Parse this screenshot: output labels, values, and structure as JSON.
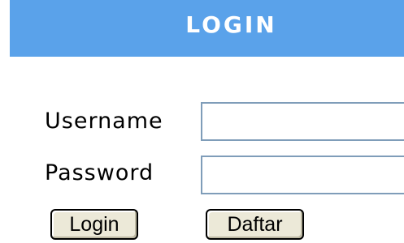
{
  "header": {
    "title": "LOGIN"
  },
  "form": {
    "username_label": "Username",
    "username_value": "",
    "password_label": "Password",
    "password_value": "",
    "login_button": "Login",
    "register_button": "Daftar"
  },
  "colors": {
    "header_bg": "#5aa2ea",
    "header_text": "#ffffff",
    "field_border": "#7f9db9",
    "button_bg": "#ece9d8"
  }
}
